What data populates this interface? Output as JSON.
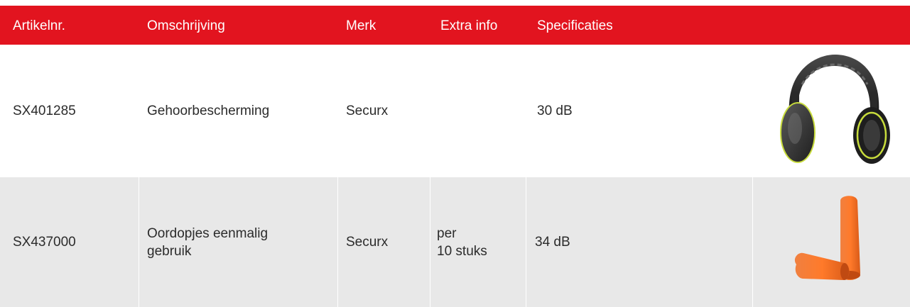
{
  "header": {
    "columns": [
      "Artikelnr.",
      "Omschrijving",
      "Merk",
      "Extra info",
      "Specificaties"
    ]
  },
  "rows": [
    {
      "artikelnr": "SX401285",
      "omschrijving_line1": "Gehoorbescherming",
      "omschrijving_line2": "",
      "merk": "Securx",
      "extra_line1": "",
      "extra_line2": "",
      "specificaties": "30 dB",
      "image": "earmuffs-image"
    },
    {
      "artikelnr": "SX437000",
      "omschrijving_line1": "Oordopjes eenmalig",
      "omschrijving_line2": "gebruik",
      "merk": "Securx",
      "extra_line1": "per",
      "extra_line2": "10 stuks",
      "specificaties": "34 dB",
      "image": "earplugs-image"
    }
  ],
  "colors": {
    "header_bg": "#e2141f",
    "header_text": "#ffffff",
    "row_alt_bg": "#e8e8e8",
    "text": "#2b2b2b"
  }
}
